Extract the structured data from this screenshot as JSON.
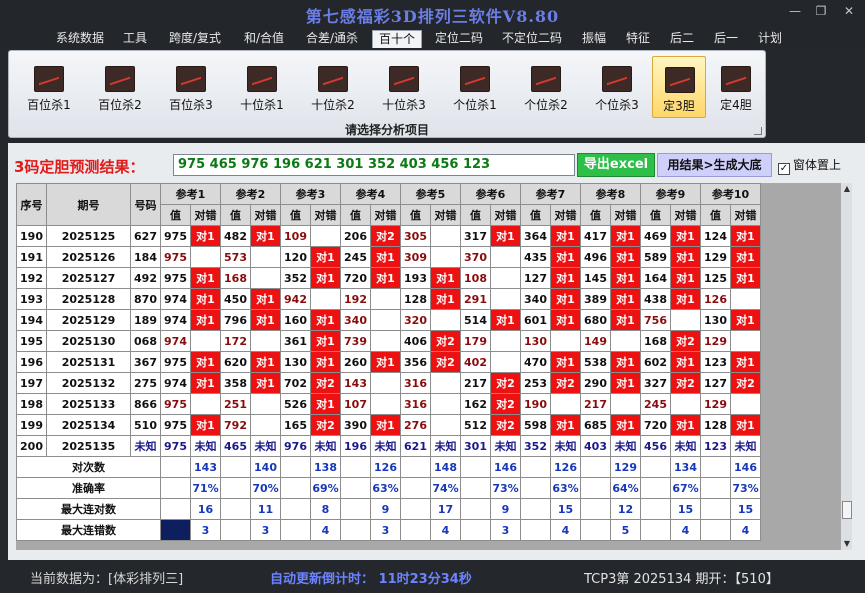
{
  "window": {
    "title": "第七感福彩3D排列三软件V8.80",
    "minimize_glyph": "—",
    "restore_glyph": "❐",
    "close_glyph": "✕"
  },
  "menu": [
    {
      "label": "系统数据",
      "active": false
    },
    {
      "label": "工具",
      "active": false
    },
    {
      "label": "跨度/复式",
      "active": false
    },
    {
      "label": "和/合值",
      "active": false
    },
    {
      "label": "合差/通杀",
      "active": false
    },
    {
      "label": "百十个",
      "active": true
    },
    {
      "label": "定位二码",
      "active": false
    },
    {
      "label": "不定位二码",
      "active": false
    },
    {
      "label": "振幅",
      "active": false
    },
    {
      "label": "特征",
      "active": false
    },
    {
      "label": "后二",
      "active": false
    },
    {
      "label": "后一",
      "active": false
    },
    {
      "label": "计划",
      "active": false
    }
  ],
  "ribbon": {
    "buttons": [
      {
        "label": "百位杀1",
        "active": false
      },
      {
        "label": "百位杀2",
        "active": false
      },
      {
        "label": "百位杀3",
        "active": false
      },
      {
        "label": "十位杀1",
        "active": false
      },
      {
        "label": "十位杀2",
        "active": false
      },
      {
        "label": "十位杀3",
        "active": false
      },
      {
        "label": "个位杀1",
        "active": false
      },
      {
        "label": "个位杀2",
        "active": false
      },
      {
        "label": "个位杀3",
        "active": false
      },
      {
        "label": "定3胆",
        "active": true
      },
      {
        "label": "定4胆",
        "active": false
      }
    ],
    "group_label": "请选择分析项目"
  },
  "prediction": {
    "label": "3码定胆预测结果：",
    "value": "975 465 976 196 621 301 352 403 456 123",
    "export_label": "导出excel",
    "generate_label": "用结果>生成大底",
    "topmost_label": "窗体置上",
    "topmost_checked": "✓"
  },
  "table": {
    "headers": {
      "seq": "序号",
      "period": "期号",
      "number": "号码"
    },
    "ref_headers": [
      "参考1",
      "参考2",
      "参考3",
      "参考4",
      "参考5",
      "参考6",
      "参考7",
      "参考8",
      "参考9",
      "参考10"
    ],
    "sub_value": "值",
    "sub_result": "对错",
    "rows": [
      {
        "seq": "190",
        "period": "2025125",
        "number": "627",
        "cells": [
          [
            "975",
            "对1"
          ],
          [
            "482",
            "对1"
          ],
          [
            "109",
            ""
          ],
          [
            "206",
            "对2"
          ],
          [
            "305",
            ""
          ],
          [
            "317",
            "对1"
          ],
          [
            "364",
            "对1"
          ],
          [
            "417",
            "对1"
          ],
          [
            "469",
            "对1"
          ],
          [
            "124",
            "对1"
          ]
        ]
      },
      {
        "seq": "191",
        "period": "2025126",
        "number": "184",
        "cells": [
          [
            "975",
            ""
          ],
          [
            "573",
            ""
          ],
          [
            "120",
            "对1"
          ],
          [
            "245",
            "对1"
          ],
          [
            "309",
            ""
          ],
          [
            "370",
            ""
          ],
          [
            "435",
            "对1"
          ],
          [
            "496",
            "对1"
          ],
          [
            "589",
            "对1"
          ],
          [
            "129",
            "对1"
          ]
        ]
      },
      {
        "seq": "192",
        "period": "2025127",
        "number": "492",
        "cells": [
          [
            "975",
            "对1"
          ],
          [
            "168",
            ""
          ],
          [
            "352",
            "对1"
          ],
          [
            "720",
            "对1"
          ],
          [
            "193",
            "对1"
          ],
          [
            "108",
            ""
          ],
          [
            "127",
            "对1"
          ],
          [
            "145",
            "对1"
          ],
          [
            "164",
            "对1"
          ],
          [
            "125",
            "对1"
          ]
        ]
      },
      {
        "seq": "193",
        "period": "2025128",
        "number": "870",
        "cells": [
          [
            "974",
            "对1"
          ],
          [
            "450",
            "对1"
          ],
          [
            "942",
            ""
          ],
          [
            "192",
            ""
          ],
          [
            "128",
            "对1"
          ],
          [
            "291",
            ""
          ],
          [
            "340",
            "对1"
          ],
          [
            "389",
            "对1"
          ],
          [
            "438",
            "对1"
          ],
          [
            "126",
            ""
          ]
        ]
      },
      {
        "seq": "194",
        "period": "2025129",
        "number": "189",
        "cells": [
          [
            "974",
            "对1"
          ],
          [
            "796",
            "对1"
          ],
          [
            "160",
            "对1"
          ],
          [
            "340",
            ""
          ],
          [
            "320",
            ""
          ],
          [
            "514",
            "对1"
          ],
          [
            "601",
            "对1"
          ],
          [
            "680",
            "对1"
          ],
          [
            "756",
            ""
          ],
          [
            "130",
            "对1"
          ]
        ]
      },
      {
        "seq": "195",
        "period": "2025130",
        "number": "068",
        "cells": [
          [
            "974",
            ""
          ],
          [
            "172",
            ""
          ],
          [
            "361",
            "对1"
          ],
          [
            "739",
            ""
          ],
          [
            "406",
            "对2"
          ],
          [
            "179",
            ""
          ],
          [
            "130",
            ""
          ],
          [
            "149",
            ""
          ],
          [
            "168",
            "对2"
          ],
          [
            "129",
            ""
          ]
        ]
      },
      {
        "seq": "196",
        "period": "2025131",
        "number": "367",
        "cells": [
          [
            "975",
            "对1"
          ],
          [
            "620",
            "对1"
          ],
          [
            "130",
            "对1"
          ],
          [
            "260",
            "对1"
          ],
          [
            "356",
            "对2"
          ],
          [
            "402",
            ""
          ],
          [
            "470",
            "对1"
          ],
          [
            "538",
            "对1"
          ],
          [
            "602",
            "对1"
          ],
          [
            "123",
            "对1"
          ]
        ]
      },
      {
        "seq": "197",
        "period": "2025132",
        "number": "275",
        "cells": [
          [
            "974",
            "对1"
          ],
          [
            "358",
            "对1"
          ],
          [
            "702",
            "对2"
          ],
          [
            "143",
            ""
          ],
          [
            "316",
            ""
          ],
          [
            "217",
            "对2"
          ],
          [
            "253",
            "对2"
          ],
          [
            "290",
            "对1"
          ],
          [
            "327",
            "对2"
          ],
          [
            "127",
            "对2"
          ]
        ]
      },
      {
        "seq": "198",
        "period": "2025133",
        "number": "866",
        "cells": [
          [
            "975",
            ""
          ],
          [
            "251",
            ""
          ],
          [
            "526",
            "对1"
          ],
          [
            "107",
            ""
          ],
          [
            "316",
            ""
          ],
          [
            "162",
            "对2"
          ],
          [
            "190",
            ""
          ],
          [
            "217",
            ""
          ],
          [
            "245",
            ""
          ],
          [
            "129",
            ""
          ]
        ]
      },
      {
        "seq": "199",
        "period": "2025134",
        "number": "510",
        "cells": [
          [
            "975",
            "对1"
          ],
          [
            "792",
            ""
          ],
          [
            "165",
            "对2"
          ],
          [
            "390",
            "对1"
          ],
          [
            "276",
            ""
          ],
          [
            "512",
            "对2"
          ],
          [
            "598",
            "对1"
          ],
          [
            "685",
            "对1"
          ],
          [
            "720",
            "对1"
          ],
          [
            "128",
            "对1"
          ]
        ]
      },
      {
        "seq": "200",
        "period": "2025135",
        "number": "未知",
        "cells": [
          [
            "975",
            "未知"
          ],
          [
            "465",
            "未知"
          ],
          [
            "976",
            "未知"
          ],
          [
            "196",
            "未知"
          ],
          [
            "621",
            "未知"
          ],
          [
            "301",
            "未知"
          ],
          [
            "352",
            "未知"
          ],
          [
            "403",
            "未知"
          ],
          [
            "456",
            "未知"
          ],
          [
            "123",
            "未知"
          ]
        ]
      }
    ],
    "stats": [
      {
        "label": "对次数",
        "values": [
          "143",
          "140",
          "138",
          "126",
          "148",
          "146",
          "126",
          "129",
          "134",
          "146"
        ]
      },
      {
        "label": "准确率",
        "values": [
          "71%",
          "70%",
          "69%",
          "63%",
          "74%",
          "73%",
          "63%",
          "64%",
          "67%",
          "73%"
        ]
      },
      {
        "label": "最大连对数",
        "values": [
          "16",
          "11",
          "8",
          "9",
          "17",
          "9",
          "15",
          "12",
          "15",
          "15"
        ]
      },
      {
        "label": "最大连错数",
        "values": [
          "3",
          "3",
          "4",
          "3",
          "4",
          "3",
          "4",
          "5",
          "4",
          "4"
        ]
      }
    ]
  },
  "scrollbar": {
    "up_glyph": "▲",
    "down_glyph": "▼"
  },
  "status": {
    "source": "当前数据为：[体彩排列三]",
    "countdown": "自动更新倒计时：  11时23分34秒",
    "draw": "TCP3第  2025134  期开：【510】"
  }
}
